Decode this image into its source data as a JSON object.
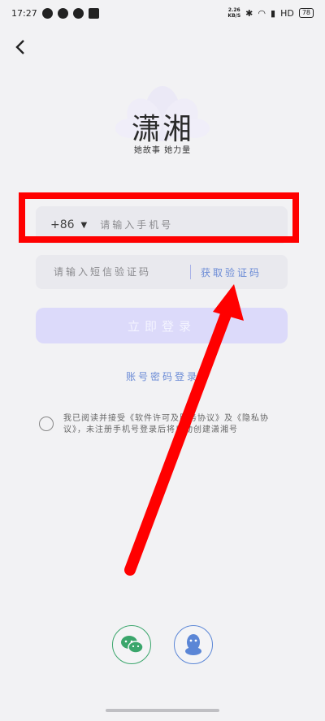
{
  "status_bar": {
    "time": "17:27",
    "net_speed_value": "2.26",
    "net_speed_unit": "KB/S",
    "network": "HD",
    "battery": "78"
  },
  "logo": {
    "title": "潇湘",
    "slogan": "她故事 她力量"
  },
  "phone": {
    "country_code": "+86",
    "placeholder": "请输入手机号"
  },
  "sms": {
    "placeholder": "请输入短信验证码",
    "get_code_label": "获取验证码"
  },
  "login_button_label": "立即登录",
  "password_login_label": "账号密码登录",
  "agreement": {
    "prefix": "我已阅读并接受",
    "license_link": "《软件许可及服务协议》",
    "middle": "及",
    "privacy_link": "《隐私协议》",
    "suffix": "，未注册手机号登录后将自动创建潇湘号"
  },
  "social": {
    "wechat_icon": "wechat-icon",
    "qq_icon": "qq-icon"
  },
  "colors": {
    "highlight": "#ff0000",
    "link": "#6b8bd6",
    "button": "#dcdafa"
  }
}
